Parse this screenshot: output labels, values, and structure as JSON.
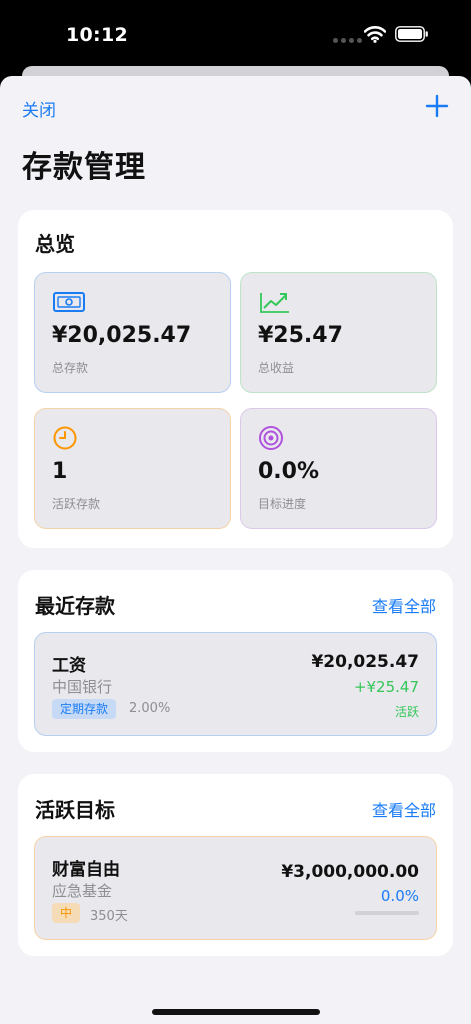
{
  "status_bar": {
    "time": "10:12"
  },
  "nav": {
    "close_label": "关闭",
    "add_icon": "plus-icon"
  },
  "page": {
    "title": "存款管理"
  },
  "overview": {
    "title": "总览",
    "stats": [
      {
        "value": "¥20,025.47",
        "label": "总存款",
        "icon": "banknote-icon",
        "color": "#1a7cf5",
        "border": "#b7cff2"
      },
      {
        "value": "¥25.47",
        "label": "总收益",
        "icon": "trend-up-icon",
        "color": "#34c759",
        "border": "#bfe3c8"
      },
      {
        "value": "1",
        "label": "活跃存款",
        "icon": "clock-icon",
        "color": "#ff9500",
        "border": "#f5d3a8"
      },
      {
        "value": "0.0%",
        "label": "目标进度",
        "icon": "target-icon",
        "color": "#af52de",
        "border": "#dcc9ea"
      }
    ]
  },
  "recent": {
    "title": "最近存款",
    "view_all": "查看全部",
    "items": [
      {
        "name": "工资",
        "bank": "中国银行",
        "type_tag": "定期存款",
        "rate": "2.00%",
        "amount": "¥20,025.47",
        "earnings": "+¥25.47",
        "status": "活跃"
      }
    ]
  },
  "goals": {
    "title": "活跃目标",
    "view_all": "查看全部",
    "items": [
      {
        "name": "财富自由",
        "category": "应急基金",
        "priority": "中",
        "days": "350天",
        "target": "¥3,000,000.00",
        "progress": "0.0%",
        "progress_value": 0.0
      }
    ]
  },
  "colors": {
    "accent": "#1a7cf5",
    "green": "#34c759",
    "orange": "#ff9500",
    "purple": "#af52de"
  }
}
